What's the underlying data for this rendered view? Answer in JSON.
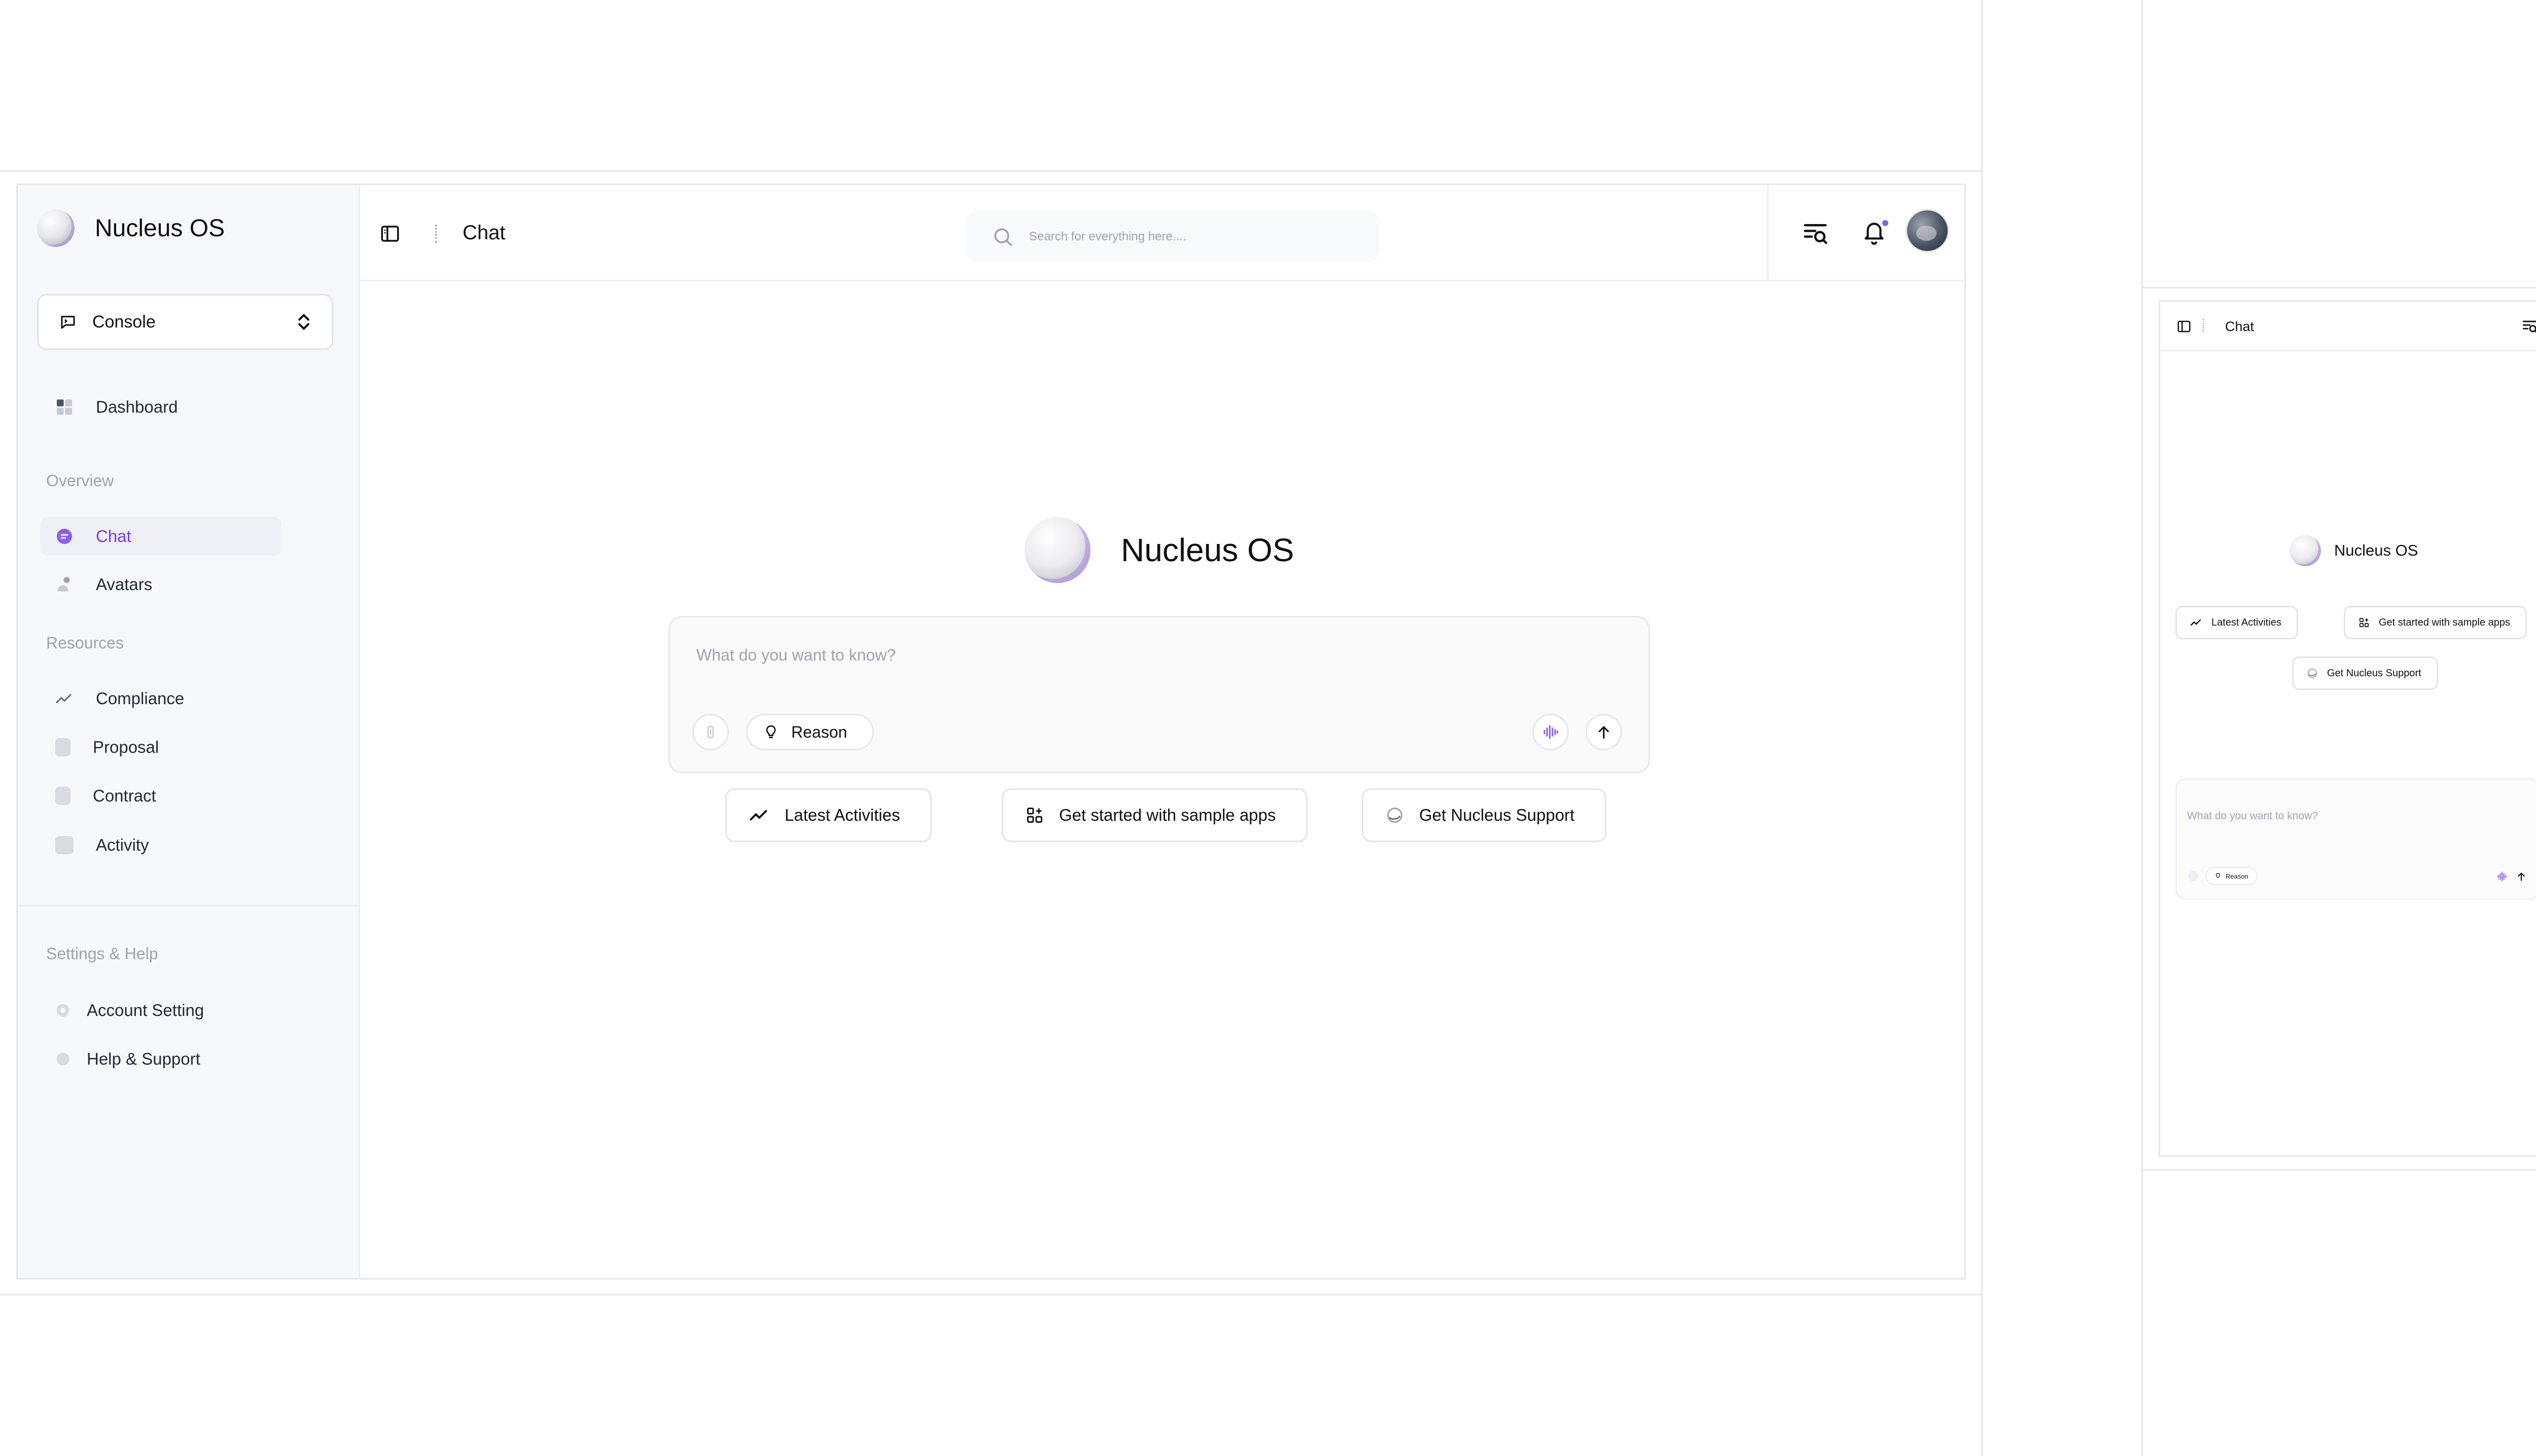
{
  "app": {
    "name": "Nucleus OS"
  },
  "sidebar": {
    "brand": "Nucleus OS",
    "workspace_selector": "Console",
    "dashboard_label": "Dashboard",
    "sections": {
      "overview": "Overview",
      "resources": "Resources",
      "settings": "Settings & Help"
    },
    "overview_items": [
      {
        "label": "Chat",
        "icon": "chat-bubble-icon",
        "active": true
      },
      {
        "label": "Avatars",
        "icon": "avatars-icon",
        "active": false
      }
    ],
    "resource_items": [
      {
        "label": "Compliance",
        "icon": "trend-icon"
      },
      {
        "label": "Proposal",
        "icon": "document-icon"
      },
      {
        "label": "Contract",
        "icon": "contract-icon"
      },
      {
        "label": "Activity",
        "icon": "activity-icon"
      }
    ],
    "settings_items": [
      {
        "label": "Account Setting",
        "icon": "gear-icon"
      },
      {
        "label": "Help & Support",
        "icon": "help-icon"
      }
    ]
  },
  "header": {
    "title": "Chat",
    "search_placeholder": "Search for everything here....",
    "notification_dot_color": "#8b5cf6"
  },
  "main": {
    "hero_title": "Nucleus OS",
    "composer": {
      "placeholder": "What do you want to know?",
      "reason_label": "Reason"
    },
    "suggestions": [
      {
        "label": "Latest Activities",
        "icon": "trend-icon"
      },
      {
        "label": "Get started with sample apps",
        "icon": "apps-grid-icon"
      },
      {
        "label": "Get Nucleus Support",
        "icon": "support-logo-icon"
      }
    ]
  },
  "mobile": {
    "title": "Chat",
    "hero_title": "Nucleus OS",
    "suggestions": [
      {
        "label": "Latest Activities"
      },
      {
        "label": "Get started with sample apps"
      },
      {
        "label": "Get Nucleus Support"
      }
    ],
    "composer": {
      "placeholder": "What do you want to know?",
      "reason_label": "Reason"
    }
  },
  "colors": {
    "accent": "#7c3aed",
    "sidebar_bg": "#f7f8fc",
    "border": "#e5e7eb"
  }
}
